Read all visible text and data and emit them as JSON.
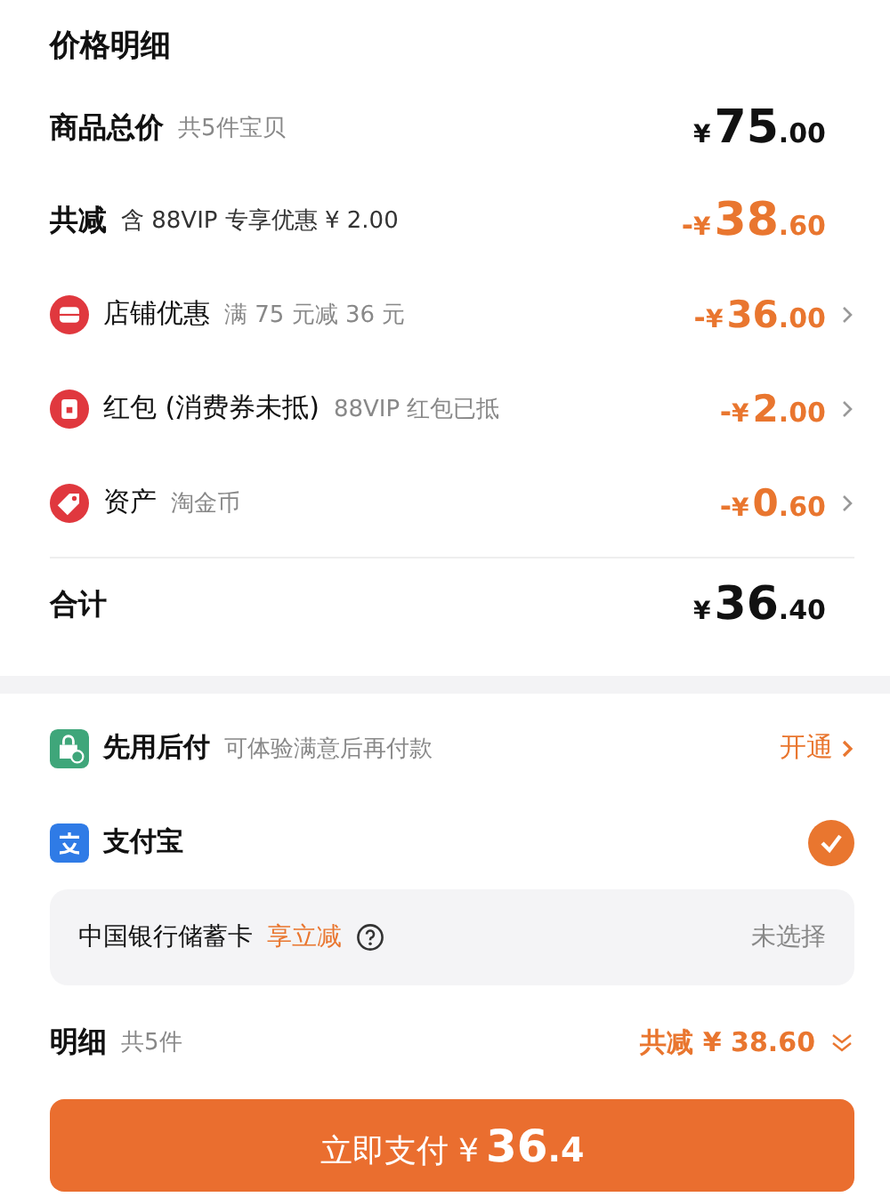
{
  "title": "价格明细",
  "subtotal": {
    "label": "商品总价",
    "note": "共5件宝贝",
    "price": {
      "yen": "¥",
      "main": "75",
      "fraction": ".00"
    }
  },
  "total_discount": {
    "label": "共减",
    "note": "含 88VIP 专享优惠 ¥ 2.00",
    "price": {
      "sign": "-",
      "yen": "¥",
      "main": "38",
      "fraction": ".60"
    }
  },
  "discounts": [
    {
      "kind": "shop",
      "label": "店铺优惠",
      "note": "满 75 元减 36 元",
      "price": {
        "sign": "-",
        "yen": "¥",
        "main": "36",
        "fraction": ".00"
      }
    },
    {
      "kind": "redpacket",
      "label": "红包 (消费券未抵)",
      "note": "88VIP 红包已抵",
      "price": {
        "sign": "-",
        "yen": "¥",
        "main": "2",
        "fraction": ".00"
      }
    },
    {
      "kind": "tag",
      "label": "资产",
      "note": "淘金币",
      "price": {
        "sign": "-",
        "yen": "¥",
        "main": "0",
        "fraction": ".60"
      }
    }
  ],
  "total": {
    "label": "合计",
    "price": {
      "yen": "¥",
      "main": "36",
      "fraction": ".40"
    }
  },
  "pay_later": {
    "label": "先用后付",
    "note": "可体验满意后再付款",
    "action": "开通"
  },
  "alipay": {
    "label": "支付宝",
    "selected": true
  },
  "bank_card": {
    "label": "中国银行储蓄卡",
    "promo": "享立减",
    "status": "未选择"
  },
  "detail": {
    "label": "明细",
    "count": "共5件",
    "saving": "共减 ¥ 38.60"
  },
  "pay_button": {
    "label": "立即支付 ¥",
    "main": "36",
    "fraction": ".4"
  }
}
